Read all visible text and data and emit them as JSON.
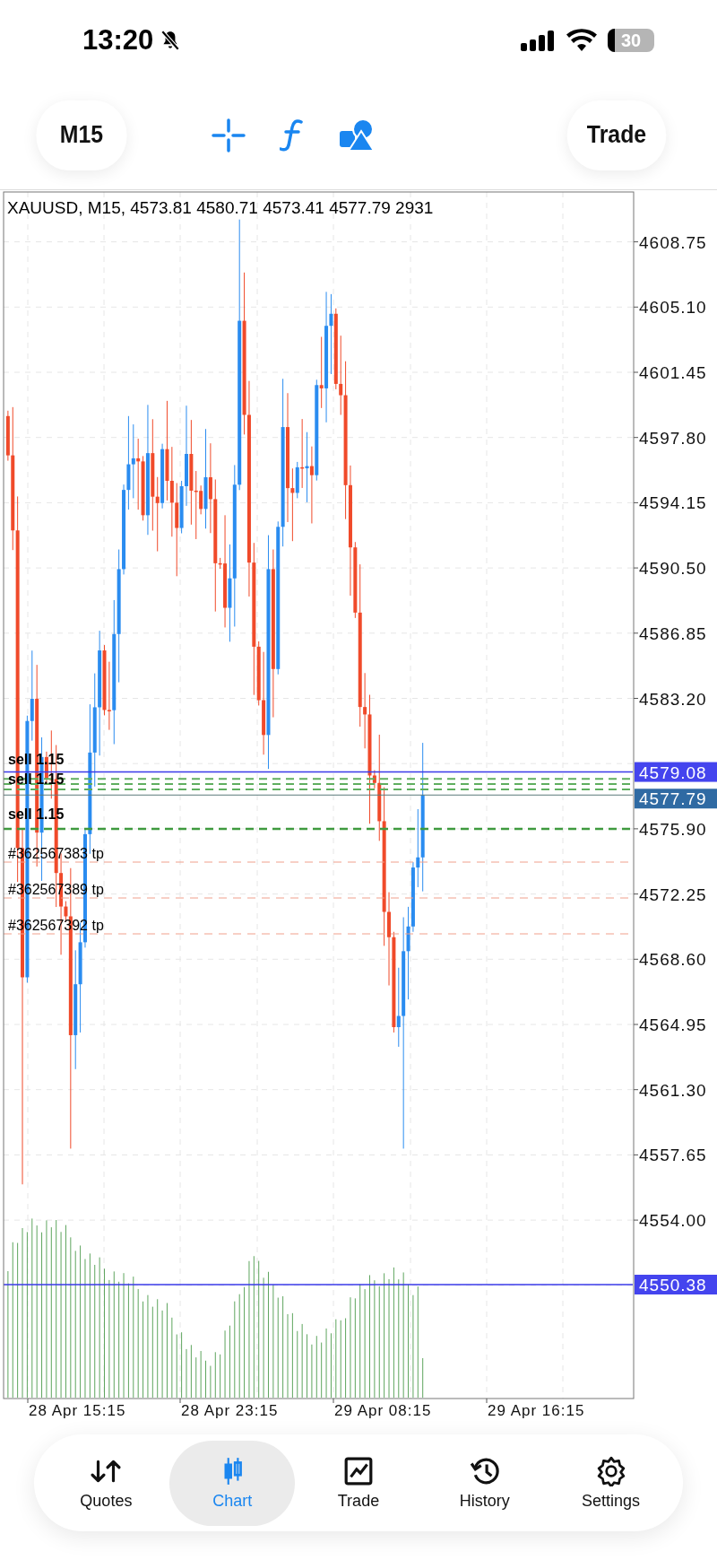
{
  "status_bar": {
    "time": "13:20",
    "battery": "30"
  },
  "toolbar": {
    "timeframe": "M15",
    "trade": "Trade"
  },
  "chart": {
    "header": "XAUUSD, M15, 4573.81 4580.71 4573.41 4577.79 2931",
    "price_labels": [
      "4608.75",
      "4605.10",
      "4601.45",
      "4597.80",
      "4594.15",
      "4590.50",
      "4586.85",
      "4583.20",
      "4575.90",
      "4572.25",
      "4568.60",
      "4564.95",
      "4561.30",
      "4557.65",
      "4554.00"
    ],
    "price_badges": [
      {
        "text": "4579.08",
        "kind": "bid"
      },
      {
        "text": "4577.79",
        "kind": "last"
      },
      {
        "text": "4550.38",
        "kind": "volume"
      }
    ],
    "order_labels": [
      {
        "text": "sell 1.15",
        "kind": "sell"
      },
      {
        "text": "sell 1.15",
        "kind": "sell"
      },
      {
        "text": "sell 1.15",
        "kind": "sell"
      },
      {
        "text": "#362567383 tp",
        "kind": "tp"
      },
      {
        "text": "#362567389 tp",
        "kind": "tp"
      },
      {
        "text": "#362567392 tp",
        "kind": "tp"
      }
    ],
    "time_labels": [
      "28 Apr 15:15",
      "28 Apr 23:15",
      "29 Apr 08:15",
      "29 Apr 16:15"
    ]
  },
  "nav": [
    {
      "label": "Quotes",
      "kind": "quotes",
      "selected": false
    },
    {
      "label": "Chart",
      "kind": "chart",
      "selected": true
    },
    {
      "label": "Trade",
      "kind": "trade",
      "selected": false
    },
    {
      "label": "History",
      "kind": "history",
      "selected": false
    },
    {
      "label": "Settings",
      "kind": "settings",
      "selected": false
    }
  ]
}
